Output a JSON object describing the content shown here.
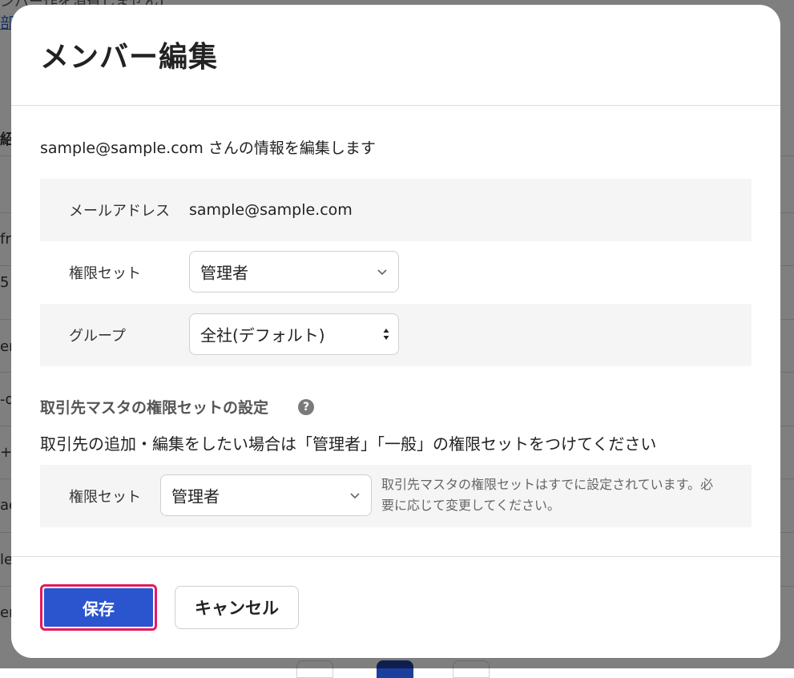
{
  "background": {
    "top_text": "ンバー作を消費しません)",
    "top_link": "部",
    "column_header": "紹",
    "column_cells": [
      "fre",
      "5",
      "en",
      "-d",
      "+c",
      "ac",
      "le",
      "en"
    ]
  },
  "modal": {
    "title": "メンバー編集",
    "intro": "sample@sample.com さんの情報を編集します",
    "email_label": "メールアドレス",
    "email_value": "sample@sample.com",
    "permission_label": "権限セット",
    "permission_value": "管理者",
    "group_label": "グループ",
    "group_value": "全社(デフォルト)",
    "supplier_section_title": "取引先マスタの権限セットの設定",
    "help_glyph": "?",
    "supplier_desc": "取引先の追加・編集をしたい場合は「管理者」「一般」の権限セットをつけてください",
    "supplier_permission_label": "権限セット",
    "supplier_permission_value": "管理者",
    "supplier_note": "取引先マスタの権限セットはすでに設定されています。必要に応じて変更してください。",
    "save_label": "保存",
    "cancel_label": "キャンセル"
  },
  "colors": {
    "primary": "#2a55cf",
    "highlight": "#e8185e",
    "row_shade": "#f6f5f5"
  }
}
